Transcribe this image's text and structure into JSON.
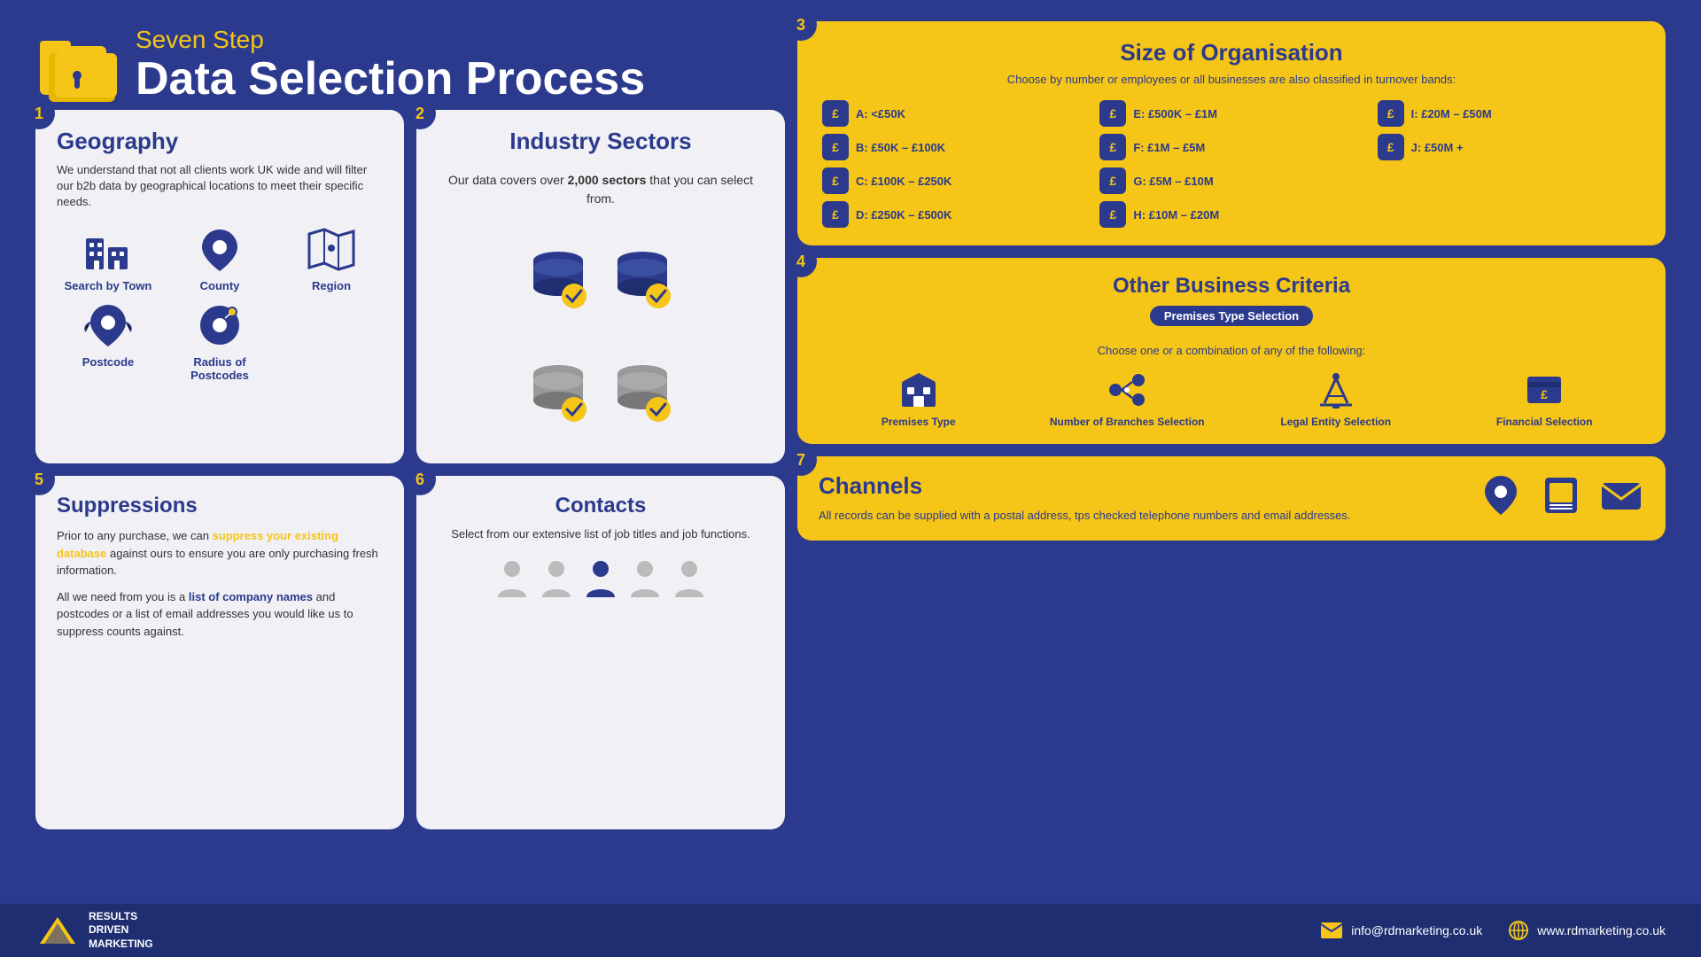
{
  "header": {
    "subtitle": "Seven Step",
    "title": "Data Selection Process"
  },
  "footer": {
    "logo_line1": "RESULTS",
    "logo_line2": "DRIVEN",
    "logo_line3": "MARKETING",
    "email_label": "info@rdmarketing.co.uk",
    "website_label": "www.rdmarketing.co.uk"
  },
  "step1": {
    "badge": "1",
    "title": "Geography",
    "description": "We understand that not all clients work UK wide and will filter our b2b data by geographical locations to meet their specific needs.",
    "items": [
      {
        "label": "Search by Town"
      },
      {
        "label": "County"
      },
      {
        "label": "Region"
      },
      {
        "label": "Postcode"
      },
      {
        "label": "Radius of Postcodes"
      }
    ]
  },
  "step2": {
    "badge": "2",
    "title": "Industry Sectors",
    "text_part1": "Our data covers over ",
    "text_highlight": "2,000 sectors",
    "text_part2": " that you can select from."
  },
  "step3": {
    "badge": "3",
    "title": "Size of Organisation",
    "subtitle": "Choose by number or employees or all businesses are also classified in turnover bands:",
    "bands": [
      {
        "label": "A: <£50K"
      },
      {
        "label": "B: £50K – £100K"
      },
      {
        "label": "C: £100K – £250K"
      },
      {
        "label": "D: £250K – £500K"
      },
      {
        "label": "E: £500K – £1M"
      },
      {
        "label": "F: £1M – £5M"
      },
      {
        "label": "G: £5M – £10M"
      },
      {
        "label": "H: £10M – £20M"
      },
      {
        "label": "I: £20M – £50M"
      },
      {
        "label": "J: £50M +"
      }
    ]
  },
  "step4": {
    "badge": "4",
    "title": "Other Business Criteria",
    "badge_label": "Premises Type Selection",
    "sub_text": "Choose one or a combination of any of the following:",
    "items": [
      {
        "label": "Premises Type"
      },
      {
        "label": "Number of Branches Selection"
      },
      {
        "label": "Legal Entity Selection"
      },
      {
        "label": "Financial Selection"
      }
    ]
  },
  "step5": {
    "badge": "5",
    "title": "Suppressions",
    "text1_pre": "Prior to any purchase, we can ",
    "text1_highlight": "suppress your existing database",
    "text1_post": " against ours to ensure you are only purchasing fresh information.",
    "text2_pre": "All we need from you is a ",
    "text2_highlight": "list of company names",
    "text2_post": " and postcodes or a list of email addresses you would like us to suppress counts against."
  },
  "step6": {
    "badge": "6",
    "title": "Contacts",
    "text": "Select from our extensive list of job titles and job functions."
  },
  "step7": {
    "badge": "7",
    "title": "Channels",
    "text": "All records can be supplied with a postal address, tps checked telephone numbers and email addresses."
  }
}
